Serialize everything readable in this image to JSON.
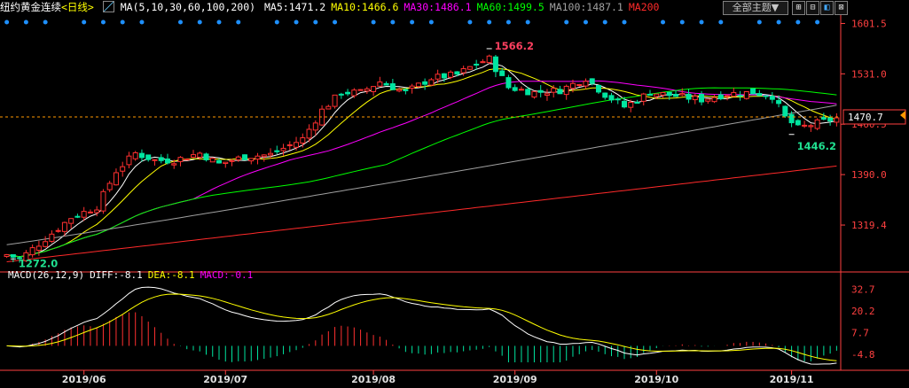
{
  "header": {
    "instrument": "纽约黄金连续",
    "period_bracket": "<日线>",
    "ma_params": "MA(5,10,30,60,100,200)",
    "ma_values": [
      {
        "label": "MA5:1471.2",
        "color": "#ffffff"
      },
      {
        "label": "MA10:1466.6",
        "color": "#ffff00"
      },
      {
        "label": "MA30:1486.1",
        "color": "#ff00ff"
      },
      {
        "label": "MA60:1499.5",
        "color": "#00ff00"
      },
      {
        "label": "MA100:1487.1",
        "color": "#a0a0a0"
      },
      {
        "label": "MA200",
        "color": "#ff2a2a"
      }
    ],
    "theme_button": "全部主题▼",
    "toolbar_icons": [
      "plus-icon",
      "minus-icon",
      "panel-icon",
      "close-icon"
    ]
  },
  "colors": {
    "up": "#ff3030",
    "down": "#00e5a0",
    "axis": "#ff4040",
    "bg": "#000000",
    "price_line": "#ff9900"
  },
  "chart_data": [
    {
      "type": "candlestick",
      "title": "",
      "ylim": [
        1255,
        1612
      ],
      "yticks": [
        "1601.5",
        "1531.0",
        "1460.5",
        "1390.0",
        "1319.4"
      ],
      "ytick_values": [
        1601.5,
        1531.0,
        1460.5,
        1390.0,
        1319.4
      ],
      "xticks": [
        "2019/06",
        "2019/07",
        "2019/08",
        "2019/09",
        "2019/10",
        "2019/11"
      ],
      "xtick_index": [
        12,
        34,
        57,
        79,
        101,
        122
      ],
      "n_bars": 130,
      "current_price": "1470.7",
      "current_value": 1470.7,
      "annotations": [
        {
          "text": "1566.2",
          "value": 1566.2,
          "index": 75
        },
        {
          "text": "1446.2",
          "value": 1446.2,
          "index": 122
        },
        {
          "text": "1272.0",
          "value": 1272.0,
          "index": 1
        }
      ],
      "series": [
        {
          "name": "MA5",
          "color": "#ffffff"
        },
        {
          "name": "MA10",
          "color": "#ffff00"
        },
        {
          "name": "MA30",
          "color": "#ff00ff"
        },
        {
          "name": "MA60",
          "color": "#00ff00"
        },
        {
          "name": "MA100",
          "color": "#a0a0a0"
        },
        {
          "name": "MA200",
          "color": "#ff2a2a"
        }
      ]
    },
    {
      "type": "macd",
      "title_params": "MACD(26,12,9)",
      "diff_label": "DIFF:-8.1",
      "dea_label": "DEA:-8.1",
      "macd_label": "MACD:-0.1",
      "yticks": [
        "32.7",
        "20.2",
        "7.7",
        "-4.8"
      ],
      "ytick_values": [
        32.7,
        20.2,
        7.7,
        -4.8
      ],
      "ylim": [
        -10,
        37
      ]
    }
  ]
}
